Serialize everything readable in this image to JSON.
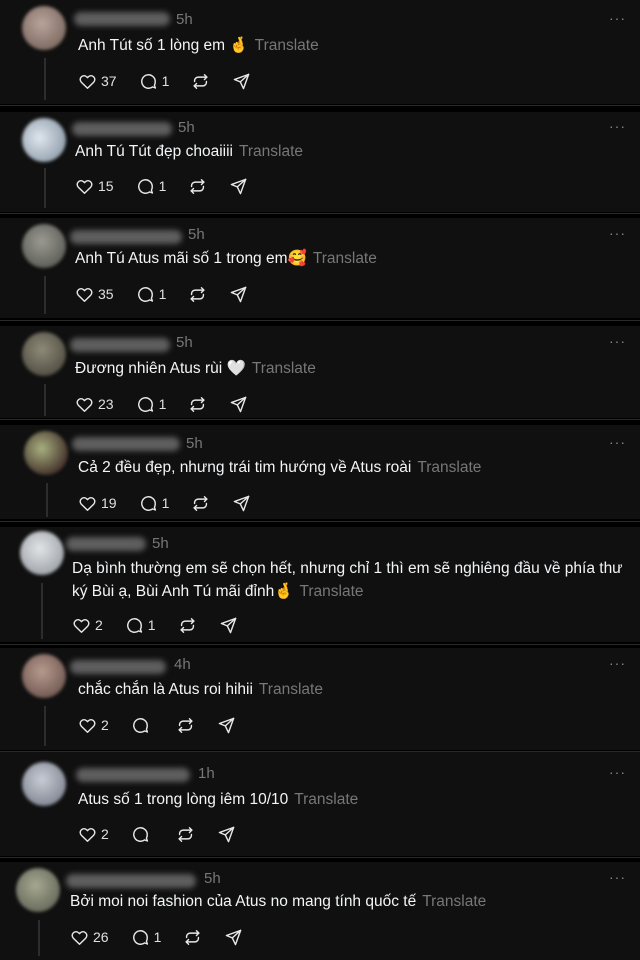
{
  "translate_label": "Translate",
  "more_label": "···",
  "colors": {
    "background": "#101010",
    "text": "#f3f5f7",
    "muted": "#777777"
  },
  "comments": [
    {
      "time": "5h",
      "text": "Anh Tút số 1 lòng em 🤞",
      "likes": "37",
      "replies": "1"
    },
    {
      "time": "5h",
      "text": "Anh Tú Tút đẹp choaiiii",
      "likes": "15",
      "replies": "1"
    },
    {
      "time": "5h",
      "text": "Anh Tú Atus mãi số 1 trong em🥰",
      "likes": "35",
      "replies": "1"
    },
    {
      "time": "5h",
      "text": "Đương nhiên Atus rùi 🤍",
      "likes": "23",
      "replies": "1"
    },
    {
      "time": "5h",
      "text": "Cả 2 đều đẹp, nhưng trái tim hướng về Atus roài",
      "likes": "19",
      "replies": "1"
    },
    {
      "time": "5h",
      "text": "Dạ bình thường em sẽ chọn hết, nhưng chỉ 1 thì em sẽ nghiêng đầu về phía thư ký Bùi ạ, Bùi Anh Tú mãi đỉnh🤞",
      "likes": "2",
      "replies": "1"
    },
    {
      "time": "4h",
      "text": "chắc chắn là Atus roi hihii",
      "likes": "2",
      "replies": ""
    },
    {
      "time": "1h",
      "text": "Atus số 1 trong lòng iêm 10/10",
      "likes": "2",
      "replies": ""
    },
    {
      "time": "5h",
      "text": "Bởi moi noi fashion của Atus no mang tính quốc tế",
      "likes": "26",
      "replies": "1"
    }
  ]
}
